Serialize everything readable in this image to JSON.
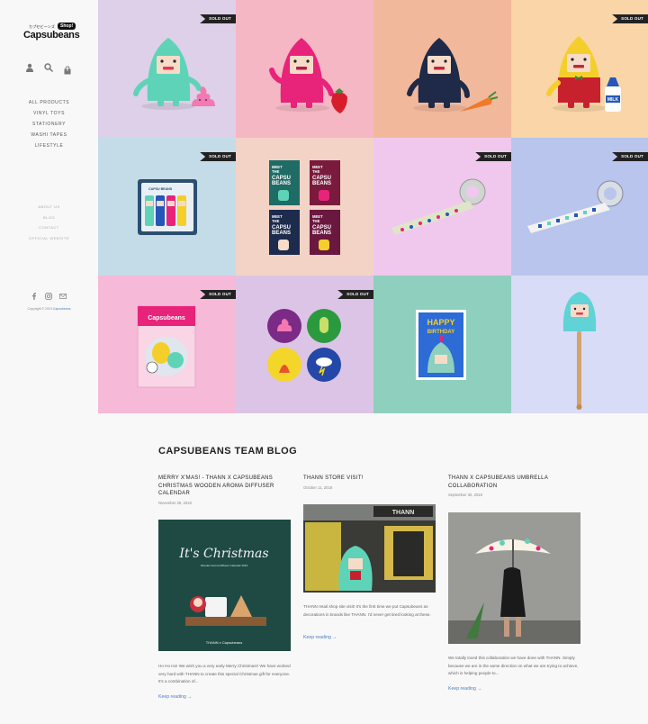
{
  "brand": {
    "name": "Capsubeans",
    "sub": "カプセビーンズ",
    "shop_badge": "Shop!"
  },
  "header_icons": [
    "user-icon",
    "search-icon",
    "cart-icon"
  ],
  "cart_count": "0",
  "nav": {
    "primary": [
      "ALL PRODUCTS",
      "VINYL TOYS",
      "STATIONERY",
      "WASHI TAPES",
      "LIFESTYLE"
    ],
    "secondary": [
      "ABOUT US",
      "BLOG",
      "CONTACT",
      "OFFICIAL WEBSITE"
    ]
  },
  "social": [
    "facebook-icon",
    "instagram-icon",
    "email-icon"
  ],
  "copyright": {
    "text": "Copyright © 2019 ",
    "link": "Capsubeans"
  },
  "products": [
    {
      "sold_out": "SOLD OUT",
      "bg": "#ddd0e8"
    },
    {
      "sold_out": "",
      "bg": "#f5b7c3"
    },
    {
      "sold_out": "",
      "bg": "#f2b89c"
    },
    {
      "sold_out": "SOLD OUT",
      "bg": "#f9d5a8"
    },
    {
      "sold_out": "SOLD OUT",
      "bg": "#c4dce8"
    },
    {
      "sold_out": "",
      "bg": "#f2d3c6"
    },
    {
      "sold_out": "SOLD OUT",
      "bg": "#f0c8ee"
    },
    {
      "sold_out": "SOLD OUT",
      "bg": "#b9c5ec"
    },
    {
      "sold_out": "SOLD OUT",
      "bg": "#f6b9d8"
    },
    {
      "sold_out": "SOLD OUT",
      "bg": "#dcc4e6"
    },
    {
      "sold_out": "",
      "bg": "#8ecfbd"
    },
    {
      "sold_out": "",
      "bg": "#d9dcf6"
    }
  ],
  "product_art": {
    "card_text": [
      "MEET",
      "THE",
      "CAPSU",
      "BEANS"
    ],
    "birthday": [
      "HAPPY",
      "BIRTHDAY"
    ],
    "sticker_brand": "Capsubeans",
    "milk": "MILK",
    "pen_label": "CAPSU BEANS"
  },
  "blog": {
    "heading": "CAPSUBEANS TEAM BLOG",
    "posts": [
      {
        "title": "MERRY X'MAS! - THANN X CAPSUBEANS CHRISTMAS WOODEN AROMA DIFFUSER CALENDAR",
        "date": "November 28, 2018",
        "image_text": "It's Christmas",
        "image_sub": "Wooden Aroma Diffuser Calendar 2019",
        "image_brand": "THANN x Capsubeans",
        "excerpt": "Ho Ho Ho! We wish you a very early Merry Christmas!! We have worked very hard with THANN to create this special Christmas gift for everyone. It's a combination of...",
        "more": "Keep reading →"
      },
      {
        "title": "THANN STORE VISIT!",
        "date": "October 11, 2018",
        "image_text": "THANN",
        "excerpt": "THANN retail shop site visit! It's the first time we put Capsubeans as decorations in brands like THANN. I'd never get tired looking at these.",
        "more": "Keep reading →"
      },
      {
        "title": "THANN X CAPSUBEANS UMBRELLA COLLABORATION",
        "date": "September 30, 2018",
        "excerpt": "We totally loved this collaboration we have done with THANN. Simply because we are in the same direction on what we are trying to achieve, which is helping people to...",
        "more": "Keep reading →"
      }
    ]
  },
  "colors": {
    "link": "#4a80c0",
    "badge_bg": "#222222",
    "page_bg": "#f8f8f8"
  }
}
